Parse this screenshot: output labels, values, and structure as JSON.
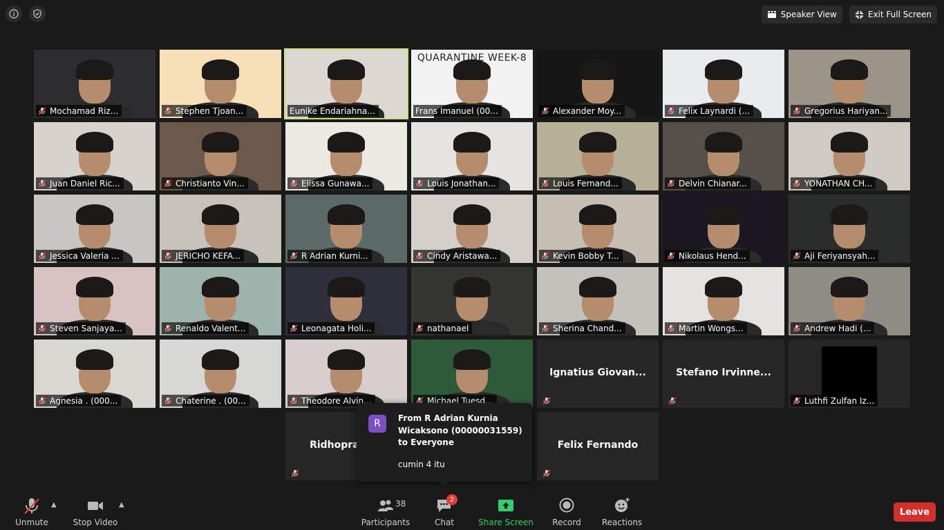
{
  "top_bar": {
    "speaker_view_label": "Speaker View",
    "exit_fullscreen_label": "Exit Full Screen"
  },
  "participants": [
    {
      "name": "Mochamad Riz...",
      "bg": "#2d2c30"
    },
    {
      "name": "Stephen Tjoan...",
      "bg": "#f7dfb8"
    },
    {
      "name": "Eunike Endariahna...",
      "bg": "#dcd8d0",
      "active": true,
      "muted": false
    },
    {
      "name": "Frans Imanuel (00...",
      "bg": "#f2f2f2",
      "banner": "QUARANTINE WEEK-8",
      "muted": false
    },
    {
      "name": "Alexander Moy...",
      "bg": "#161616"
    },
    {
      "name": "Felix Laynardi (...",
      "bg": "#e9ecee"
    },
    {
      "name": "Gregorius Hariyan...",
      "bg": "#9c9488"
    },
    {
      "name": "Juan Daniel Ric...",
      "bg": "#d8d2cf"
    },
    {
      "name": "Christianto Vin...",
      "bg": "#6b5a4c"
    },
    {
      "name": "Elissa Gunawa...",
      "bg": "#ece8e2"
    },
    {
      "name": "Louis Jonathan...",
      "bg": "#e6e4e1"
    },
    {
      "name": "Louis Fernand...",
      "bg": "#b6b196"
    },
    {
      "name": "Delvin Chianar...",
      "bg": "#565148"
    },
    {
      "name": "YONATHAN CH...",
      "bg": "#cfcac2"
    },
    {
      "name": "Jessica Valeria ...",
      "bg": "#c8c5c2"
    },
    {
      "name": "JERICHO KEFA...",
      "bg": "#c7c2ba"
    },
    {
      "name": "R Adrian Kurni...",
      "bg": "#5a6a66"
    },
    {
      "name": "Cindy Aristawa...",
      "bg": "#d4cfcb"
    },
    {
      "name": "Kevin Bobby T...",
      "bg": "#c5beb2"
    },
    {
      "name": "Nikolaus Hend...",
      "bg": "#1b1722"
    },
    {
      "name": "Aji Feriyansyah...",
      "bg": "#2b2d2c"
    },
    {
      "name": "Steven Sanjaya...",
      "bg": "#d9c2c2"
    },
    {
      "name": "Renaldo Valent...",
      "bg": "#9db4ad"
    },
    {
      "name": "Leonagata Holi...",
      "bg": "#2d2f3a"
    },
    {
      "name": "nathanael",
      "bg": "#353531"
    },
    {
      "name": "Sherina Chand...",
      "bg": "#c4c0bc"
    },
    {
      "name": "Martin Wongs...",
      "bg": "#e5e3df"
    },
    {
      "name": "Andrew Hadi (...",
      "bg": "#8f8c86"
    },
    {
      "name": "Agnesia . (000...",
      "bg": "#d9d7d2"
    },
    {
      "name": "Chaterine . (00...",
      "bg": "#d7d8d5"
    },
    {
      "name": "Theodore Alvin...",
      "bg": "#d6cfcd"
    },
    {
      "name": "Michael Tuesd...",
      "bg": "#2e5a3a"
    },
    {
      "name": "Ignatius  Giovan...",
      "video": false
    },
    {
      "name": "Stefano  Irvinne...",
      "video": false
    },
    {
      "name": "Luthfi Zulfan Iz...",
      "bg": "#262626",
      "blackbox": true
    },
    {
      "name": "Ridhoprayo...",
      "video": false
    },
    {
      "name": "Felix Fernando",
      "video": false
    }
  ],
  "chat_toast": {
    "avatar_letter": "R",
    "from_text": "From R Adrian Kurnia Wicaksono (00000031559) to Everyone",
    "message": "cumin 4 itu",
    "avatar_color": "#7d4fc4"
  },
  "toolbar": {
    "unmute_label": "Unmute",
    "stop_video_label": "Stop Video",
    "participants_label": "Participants",
    "participants_count": "38",
    "chat_label": "Chat",
    "chat_badge": "2",
    "share_screen_label": "Share Screen",
    "record_label": "Record",
    "reactions_label": "Reactions",
    "leave_label": "Leave",
    "share_color": "#2fd06b",
    "leave_color": "#d0312d"
  }
}
